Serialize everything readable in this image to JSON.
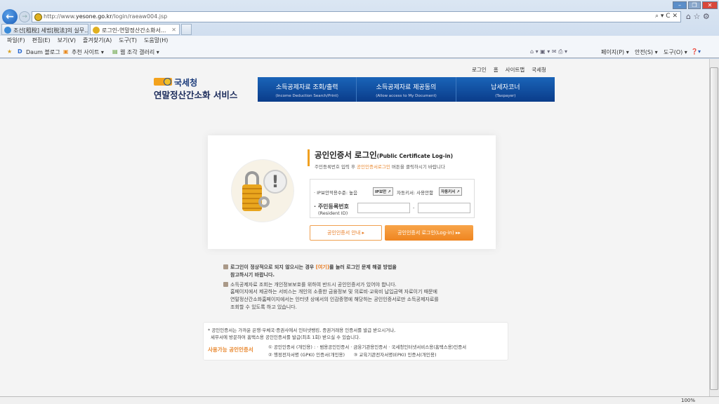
{
  "browser": {
    "url_prefix": "http://www.",
    "url_host": "yesone.go.kr",
    "url_path": "/login/raeaw004.jsp",
    "addr_tools": "⌕ ▾ C ✕",
    "tabs": [
      {
        "label": "조선[租稅] 세법[稅法]의 실무..."
      },
      {
        "label": "로그인-연말정산간소화서...",
        "close": "✕"
      }
    ],
    "menu": [
      "파일(F)",
      "편집(E)",
      "보기(V)",
      "즐겨찾기(A)",
      "도구(T)",
      "도움말(H)"
    ],
    "favorites": [
      "Daum 블로그",
      "추천 사이트 ▾",
      "웹 조각 갤러리 ▾"
    ],
    "cmdbar": [
      "페이지(P) ▾",
      "안전(S) ▾",
      "도구(O) ▾"
    ],
    "zoom": "100%"
  },
  "header": {
    "top_links": [
      "로그인",
      "홈",
      "사이트맵",
      "국세청"
    ],
    "agency": "국세청",
    "service": "연말정산간소화 서비스",
    "nav": [
      {
        "ko": "소득공제자료 조회/출력",
        "en": "(Income Deduction Search/Print)"
      },
      {
        "ko": "소득공제자료 제공동의",
        "en": "(Allow access to My Document)"
      },
      {
        "ko": "납세자코너",
        "en": "(Taxpayer)"
      }
    ]
  },
  "login": {
    "title": "공인인증서 로그인",
    "title_en": "(Public Certificate Log-in)",
    "desc_pre": "주민등록번호 입력 후 ",
    "desc_hl": "공인인증서로그인",
    "desc_post": " 버튼을 클릭하시기 바랍니다",
    "ip_label": "· IP보안적용수준: 높음",
    "ip_btn": "IP보안 ↗",
    "kbd_label": "자동키서: 사용안함",
    "kbd_btn": "자동키서 ↗",
    "rid_label": "· 주민등록번호",
    "rid_label_en": "(Resident ID)",
    "rid_sep": "-",
    "rid1": "",
    "rid2": "",
    "guide_btn": "공인인증서 안내 ▸",
    "login_btn": "공인인증서 로그인(Log-in) ▸▸"
  },
  "notes": {
    "n1_pre": "로그인이 정상적으로 되지 않으시는 경우 ",
    "n1_hl": "[여기]",
    "n1_post": "를 눌러 로그인 문제 해결 방법을",
    "n1_l2": "참고하시기 바랍니다.",
    "n2": [
      "소득공제자료 조회는 개인정보보호를 위하여 반드시 공인인증서가 있어야 합니다.",
      "홈페이지에서 제공하는 서비스는 개인의 소중한 금융정보 및 의료비·교육비 납입금액 자료이기 때문에",
      "연말정산간소화홈페이지에서는 인터넷 상에서의 인감증명에 해당하는 공인인증서로만 소득공제자료를",
      "조회할 수 있도록 하고 있습니다."
    ]
  },
  "info": {
    "l1": "* 공인인증서는 가까운 은행·우체국·증권사에서 인터넷뱅킹, 증권거래용 인증서를 발급 받으시거나,",
    "l2": "세무서에 방문하여 홈택스용 공인인증서를 발급(최초 1회) 받으실 수 있습니다.",
    "label": "사용가능 공인인증서",
    "c1": "① 공인인증서 (개인용) : · 범용공인인증서 · 금융기관용인증서 · 국세청인터넷서비스용(홈택스용)인증서",
    "c2": "② 행정전자서명 (GPKI) 인증서(개인용)      ③ 교육기관전자서명(EPKI) 인증서(개인용)"
  },
  "colors": {
    "nav_blue": "#0a3c8a",
    "accent_orange": "#ef8520"
  }
}
